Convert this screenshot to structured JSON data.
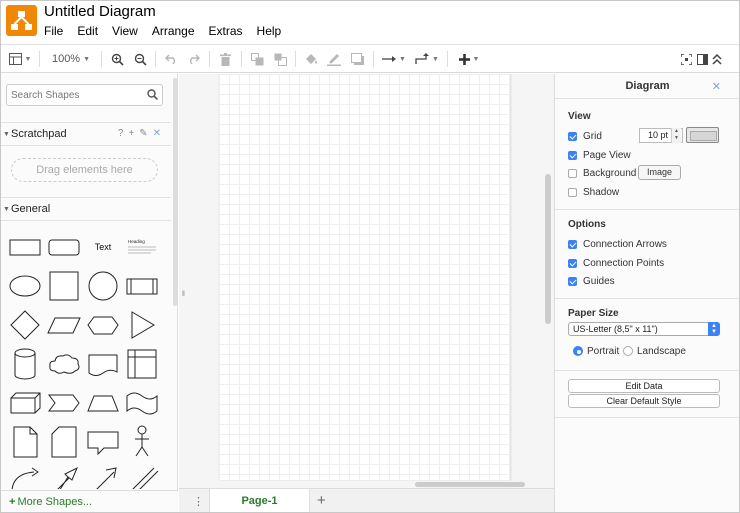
{
  "window": {
    "title": "Untitled Diagram"
  },
  "menu": [
    "File",
    "Edit",
    "View",
    "Arrange",
    "Extras",
    "Help"
  ],
  "toolbar": {
    "zoom": "100%"
  },
  "sidebar": {
    "search_placeholder": "Search Shapes",
    "scratchpad_label": "Scratchpad",
    "scratchpad_tools": [
      "?",
      "+",
      "✎",
      "✕"
    ],
    "drop_zone_text": "Drag elements here",
    "general_label": "General",
    "shape_text_label": "Text",
    "shape_heading_label": "Heading",
    "more_shapes_label": "More Shapes..."
  },
  "pages": {
    "current_tab": "Page-1"
  },
  "format_panel": {
    "title": "Diagram",
    "view_title": "View",
    "grid_label": "Grid",
    "grid_size": "10 pt",
    "page_view_label": "Page View",
    "background_label": "Background",
    "image_button": "Image",
    "shadow_label": "Shadow",
    "options_title": "Options",
    "connection_arrows_label": "Connection Arrows",
    "connection_points_label": "Connection Points",
    "guides_label": "Guides",
    "paper_size_title": "Paper Size",
    "paper_size_value": "US-Letter (8,5\" x 11\")",
    "portrait_label": "Portrait",
    "landscape_label": "Landscape",
    "edit_data_button": "Edit Data",
    "clear_style_button": "Clear Default Style",
    "checks": {
      "grid": true,
      "page_view": true,
      "background": false,
      "shadow": false,
      "connection_arrows": true,
      "connection_points": true,
      "guides": true
    },
    "orientation": "portrait"
  },
  "colors": {
    "brand": "#f08705",
    "accent": "#3b82f6",
    "active_tab": "#2c7a2c"
  }
}
